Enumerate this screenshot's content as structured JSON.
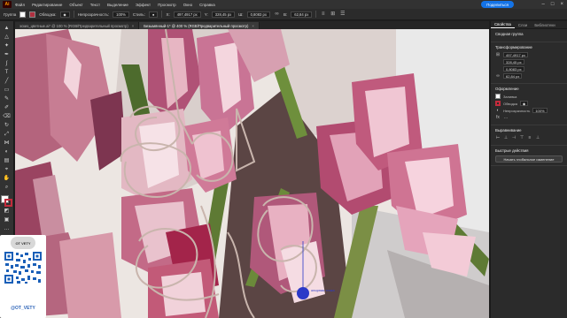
{
  "app": {
    "logo": "Ai",
    "share_label": "Поделиться"
  },
  "menu": [
    "Файл",
    "Редактирование",
    "Объект",
    "Текст",
    "Выделение",
    "Эффект",
    "Просмотр",
    "Окно",
    "Справка"
  ],
  "control": {
    "object_type": "Группа",
    "stroke_label": "Обводка:",
    "style_label": "Стиль:",
    "opacity_label": "Непрозрачность:",
    "opacity_value": "100%",
    "x_label": "X:",
    "x_value": "497,4917 px",
    "y_label": "Y:",
    "y_value": "328,45 px",
    "w_label": "Ш:",
    "w_value": "0,8083 px",
    "h_label": "В:",
    "h_value": "62,84 px"
  },
  "tabs": [
    {
      "label": "эскиз_цветные.ai* @ 100 % (RGB/Предварительный просмотр)",
      "active": false
    },
    {
      "label": "Безымянный-1* @ 400 % (RGB/Предварительный просмотр)",
      "active": true
    }
  ],
  "panel": {
    "tabs": [
      "Свойства",
      "Слои",
      "Библиотеки"
    ],
    "section_group": "Сводная группа",
    "section_transform": "Трансформирование",
    "x_value": "497,4917 px",
    "y_value": "328,45 px",
    "w_value": "0,8083 px",
    "h_value": "62,84 px",
    "section_appearance": "Оформление",
    "fill_label": "Заливка",
    "stroke_label": "Обводка",
    "opacity_label": "Непрозрачность",
    "opacity_value": "100%",
    "section_align": "Выравнивание",
    "section_quick": "Быстрые действия",
    "quick_button": "Начать глобальное изменение",
    "fill_color": "#ffffff",
    "stroke_color": "#c32b3c"
  },
  "canvas": {
    "callout": "опорная точка"
  },
  "watermark": {
    "logo": "OT VETY",
    "handle": "@OT_VETY"
  },
  "accent": "#1473e6"
}
